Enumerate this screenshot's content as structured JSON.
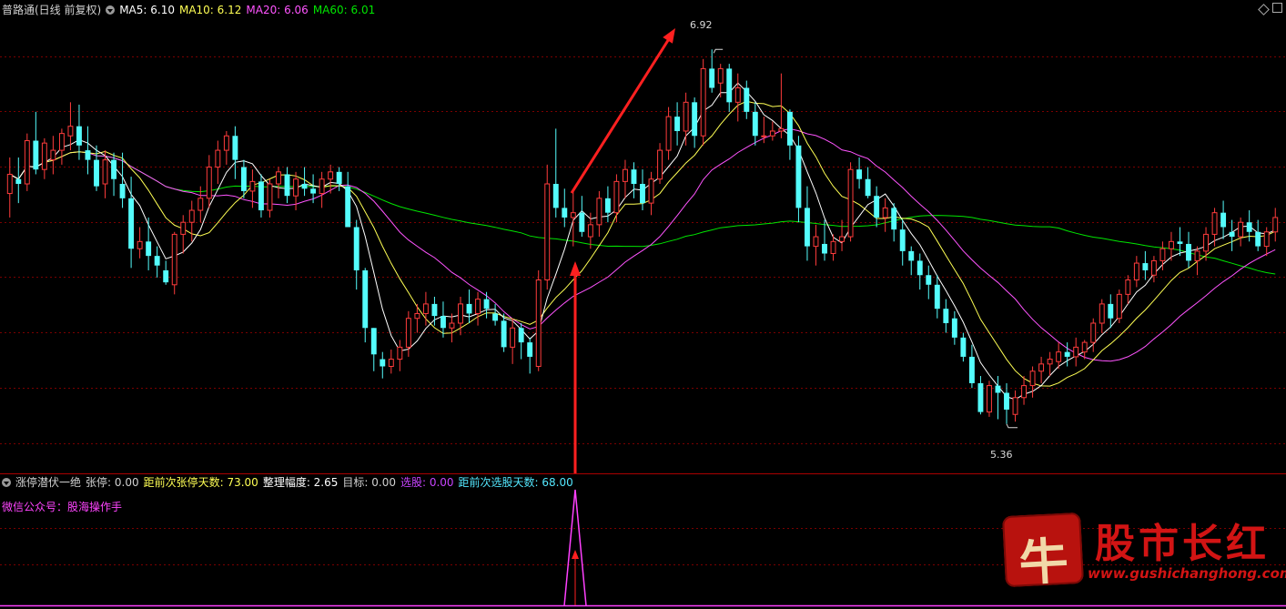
{
  "main_header": {
    "title": "普路通(日线 前复权)",
    "ma5": "MA5: 6.10",
    "ma10": "MA10: 6.12",
    "ma20": "MA20: 6.06",
    "ma60": "MA60: 6.01"
  },
  "price_labels": {
    "high": "6.92",
    "low": "5.36"
  },
  "indicator_header": {
    "name": "涨停潜伏一绝",
    "zhangting": "张停: 0.00",
    "days_since_limit": "距前次张停天数: 73.00",
    "consolidation": "整理幅度: 2.65",
    "target": "目标: 0.00",
    "select": "选股: 0.00",
    "days_since_select": "距前次选股天数: 68.00",
    "wechat": "微信公众号：股海操作手"
  },
  "watermark": {
    "badge_char": "牛",
    "title": "股市长红",
    "url": "www.gushichanghong.com"
  },
  "colors": {
    "up": "#ff3c3c",
    "down": "#54fcfc",
    "ma5": "#ffffff",
    "ma10": "#ffff54",
    "ma20": "#ff54ff",
    "ma60": "#00e600",
    "grid": "#7a0000",
    "indicator_line": "#ff40ff",
    "annotation": "#ff2020",
    "select_text": "#c844ff",
    "days_select_text": "#54e8ff",
    "days_limit_text": "#ffff54",
    "wechat_text": "#ff44ff"
  },
  "chart_data": {
    "type": "candlestick",
    "y_range": [
      5.2,
      7.05
    ],
    "ohlc": [
      [
        6.32,
        6.47,
        6.22,
        6.4
      ],
      [
        6.38,
        6.47,
        6.28,
        6.36
      ],
      [
        6.36,
        6.57,
        6.33,
        6.54
      ],
      [
        6.54,
        6.66,
        6.4,
        6.42
      ],
      [
        6.42,
        6.55,
        6.38,
        6.53
      ],
      [
        6.46,
        6.56,
        6.4,
        6.5
      ],
      [
        6.5,
        6.59,
        6.44,
        6.57
      ],
      [
        6.56,
        6.7,
        6.5,
        6.6
      ],
      [
        6.6,
        6.69,
        6.46,
        6.52
      ],
      [
        6.5,
        6.6,
        6.4,
        6.46
      ],
      [
        6.46,
        6.52,
        6.33,
        6.35
      ],
      [
        6.36,
        6.5,
        6.3,
        6.46
      ],
      [
        6.46,
        6.49,
        6.31,
        6.38
      ],
      [
        6.36,
        6.49,
        6.26,
        6.3
      ],
      [
        6.3,
        6.39,
        6.01,
        6.09
      ],
      [
        6.09,
        6.18,
        6.05,
        6.12
      ],
      [
        6.12,
        6.22,
        6.0,
        6.06
      ],
      [
        6.06,
        6.1,
        5.97,
        6.02
      ],
      [
        6.0,
        6.04,
        5.94,
        5.95
      ],
      [
        5.94,
        6.16,
        5.9,
        6.15
      ],
      [
        6.15,
        6.23,
        6.07,
        6.2
      ],
      [
        6.2,
        6.29,
        6.12,
        6.25
      ],
      [
        6.25,
        6.35,
        6.2,
        6.3
      ],
      [
        6.3,
        6.48,
        6.26,
        6.43
      ],
      [
        6.43,
        6.54,
        6.36,
        6.5
      ],
      [
        6.5,
        6.58,
        6.44,
        6.56
      ],
      [
        6.56,
        6.6,
        6.38,
        6.46
      ],
      [
        6.43,
        6.46,
        6.3,
        6.33
      ],
      [
        6.33,
        6.42,
        6.26,
        6.37
      ],
      [
        6.37,
        6.4,
        6.22,
        6.25
      ],
      [
        6.25,
        6.38,
        6.22,
        6.36
      ],
      [
        6.36,
        6.43,
        6.3,
        6.41
      ],
      [
        6.4,
        6.43,
        6.28,
        6.31
      ],
      [
        6.31,
        6.41,
        6.25,
        6.38
      ],
      [
        6.36,
        6.43,
        6.31,
        6.34
      ],
      [
        6.34,
        6.4,
        6.28,
        6.32
      ],
      [
        6.32,
        6.41,
        6.26,
        6.38
      ],
      [
        6.38,
        6.44,
        6.32,
        6.41
      ],
      [
        6.41,
        6.43,
        6.33,
        6.36
      ],
      [
        6.35,
        6.41,
        6.28,
        6.18
      ],
      [
        6.18,
        6.21,
        5.92,
        6.0
      ],
      [
        6.0,
        6.01,
        5.7,
        5.76
      ],
      [
        5.76,
        5.76,
        5.58,
        5.65
      ],
      [
        5.63,
        5.66,
        5.55,
        5.6
      ],
      [
        5.6,
        5.67,
        5.57,
        5.63
      ],
      [
        5.63,
        5.71,
        5.58,
        5.68
      ],
      [
        5.68,
        5.83,
        5.64,
        5.8
      ],
      [
        5.8,
        5.86,
        5.74,
        5.82
      ],
      [
        5.82,
        5.91,
        5.77,
        5.86
      ],
      [
        5.86,
        5.89,
        5.77,
        5.81
      ],
      [
        5.81,
        5.87,
        5.72,
        5.76
      ],
      [
        5.76,
        5.82,
        5.7,
        5.78
      ],
      [
        5.78,
        5.89,
        5.73,
        5.86
      ],
      [
        5.86,
        5.92,
        5.78,
        5.82
      ],
      [
        5.82,
        5.91,
        5.77,
        5.88
      ],
      [
        5.88,
        5.91,
        5.8,
        5.84
      ],
      [
        5.82,
        5.86,
        5.77,
        5.79
      ],
      [
        5.79,
        5.82,
        5.66,
        5.68
      ],
      [
        5.68,
        5.8,
        5.61,
        5.76
      ],
      [
        5.76,
        5.78,
        5.63,
        5.7
      ],
      [
        5.7,
        5.72,
        5.57,
        5.64
      ],
      [
        5.6,
        6.0,
        5.58,
        5.96
      ],
      [
        5.96,
        6.44,
        5.92,
        6.36
      ],
      [
        6.36,
        6.59,
        6.22,
        6.26
      ],
      [
        6.26,
        6.34,
        6.18,
        6.22
      ],
      [
        6.22,
        6.33,
        6.1,
        6.24
      ],
      [
        6.24,
        6.31,
        6.14,
        6.16
      ],
      [
        6.14,
        6.24,
        6.09,
        6.19
      ],
      [
        6.19,
        6.33,
        6.14,
        6.3
      ],
      [
        6.3,
        6.35,
        6.2,
        6.24
      ],
      [
        6.24,
        6.4,
        6.2,
        6.37
      ],
      [
        6.37,
        6.46,
        6.3,
        6.42
      ],
      [
        6.42,
        6.45,
        6.3,
        6.36
      ],
      [
        6.36,
        6.42,
        6.25,
        6.28
      ],
      [
        6.28,
        6.41,
        6.23,
        6.38
      ],
      [
        6.38,
        6.53,
        6.36,
        6.5
      ],
      [
        6.5,
        6.68,
        6.46,
        6.64
      ],
      [
        6.64,
        6.7,
        6.52,
        6.58
      ],
      [
        6.58,
        6.74,
        6.52,
        6.7
      ],
      [
        6.7,
        6.72,
        6.51,
        6.56
      ],
      [
        6.56,
        6.88,
        6.52,
        6.84
      ],
      [
        6.84,
        6.92,
        6.74,
        6.76
      ],
      [
        6.78,
        6.86,
        6.72,
        6.84
      ],
      [
        6.84,
        6.86,
        6.66,
        6.7
      ],
      [
        6.7,
        6.82,
        6.62,
        6.76
      ],
      [
        6.76,
        6.79,
        6.63,
        6.66
      ],
      [
        6.66,
        6.7,
        6.52,
        6.56
      ],
      [
        6.56,
        6.64,
        6.53,
        6.56
      ],
      [
        6.56,
        6.62,
        6.54,
        6.58
      ],
      [
        6.58,
        6.82,
        6.55,
        6.59
      ],
      [
        6.66,
        6.67,
        6.46,
        6.52
      ],
      [
        6.52,
        6.56,
        6.2,
        6.26
      ],
      [
        6.26,
        6.35,
        6.04,
        6.1
      ],
      [
        6.1,
        6.19,
        6.02,
        6.14
      ],
      [
        6.11,
        6.21,
        6.04,
        6.07
      ],
      [
        6.07,
        6.15,
        6.04,
        6.12
      ],
      [
        6.12,
        6.21,
        6.08,
        6.14
      ],
      [
        6.14,
        6.45,
        6.12,
        6.42
      ],
      [
        6.42,
        6.47,
        6.34,
        6.38
      ],
      [
        6.38,
        6.43,
        6.3,
        6.31
      ],
      [
        6.31,
        6.35,
        6.18,
        6.22
      ],
      [
        6.22,
        6.3,
        6.16,
        6.26
      ],
      [
        6.26,
        6.28,
        6.12,
        6.17
      ],
      [
        6.17,
        6.21,
        6.02,
        6.08
      ],
      [
        6.08,
        6.1,
        5.98,
        6.04
      ],
      [
        6.04,
        6.07,
        5.92,
        5.98
      ],
      [
        5.98,
        6.02,
        5.88,
        5.94
      ],
      [
        5.94,
        5.98,
        5.8,
        5.84
      ],
      [
        5.84,
        5.88,
        5.74,
        5.78
      ],
      [
        5.8,
        5.83,
        5.69,
        5.72
      ],
      [
        5.72,
        5.74,
        5.62,
        5.64
      ],
      [
        5.64,
        5.69,
        5.51,
        5.53
      ],
      [
        5.53,
        5.56,
        5.4,
        5.41
      ],
      [
        5.41,
        5.54,
        5.39,
        5.52
      ],
      [
        5.52,
        5.56,
        5.38,
        5.49
      ],
      [
        5.49,
        5.53,
        5.36,
        5.42
      ],
      [
        5.4,
        5.5,
        5.37,
        5.47
      ],
      [
        5.47,
        5.56,
        5.44,
        5.52
      ],
      [
        5.52,
        5.6,
        5.47,
        5.58
      ],
      [
        5.58,
        5.64,
        5.53,
        5.61
      ],
      [
        5.61,
        5.66,
        5.56,
        5.63
      ],
      [
        5.62,
        5.7,
        5.59,
        5.66
      ],
      [
        5.66,
        5.7,
        5.6,
        5.64
      ],
      [
        5.64,
        5.72,
        5.6,
        5.68
      ],
      [
        5.66,
        5.71,
        5.63,
        5.7
      ],
      [
        5.7,
        5.8,
        5.66,
        5.78
      ],
      [
        5.78,
        5.88,
        5.74,
        5.86
      ],
      [
        5.86,
        5.9,
        5.76,
        5.8
      ],
      [
        5.8,
        5.92,
        5.78,
        5.9
      ],
      [
        5.9,
        5.98,
        5.86,
        5.96
      ],
      [
        5.96,
        6.06,
        5.93,
        6.03
      ],
      [
        6.03,
        6.08,
        5.96,
        6.0
      ],
      [
        5.98,
        6.06,
        5.95,
        6.04
      ],
      [
        6.04,
        6.12,
        6.0,
        6.09
      ],
      [
        6.09,
        6.16,
        6.04,
        6.12
      ],
      [
        6.12,
        6.18,
        6.06,
        6.11
      ],
      [
        6.11,
        6.16,
        6.01,
        6.04
      ],
      [
        6.04,
        6.1,
        5.98,
        6.08
      ],
      [
        6.08,
        6.18,
        6.04,
        6.15
      ],
      [
        6.15,
        6.26,
        6.1,
        6.24
      ],
      [
        6.24,
        6.29,
        6.13,
        6.18
      ],
      [
        6.16,
        6.21,
        6.08,
        6.14
      ],
      [
        6.14,
        6.22,
        6.1,
        6.2
      ],
      [
        6.2,
        6.25,
        6.12,
        6.16
      ],
      [
        6.16,
        6.21,
        6.08,
        6.1
      ],
      [
        6.1,
        6.18,
        6.06,
        6.16
      ],
      [
        6.16,
        6.26,
        6.12,
        6.22
      ]
    ]
  }
}
